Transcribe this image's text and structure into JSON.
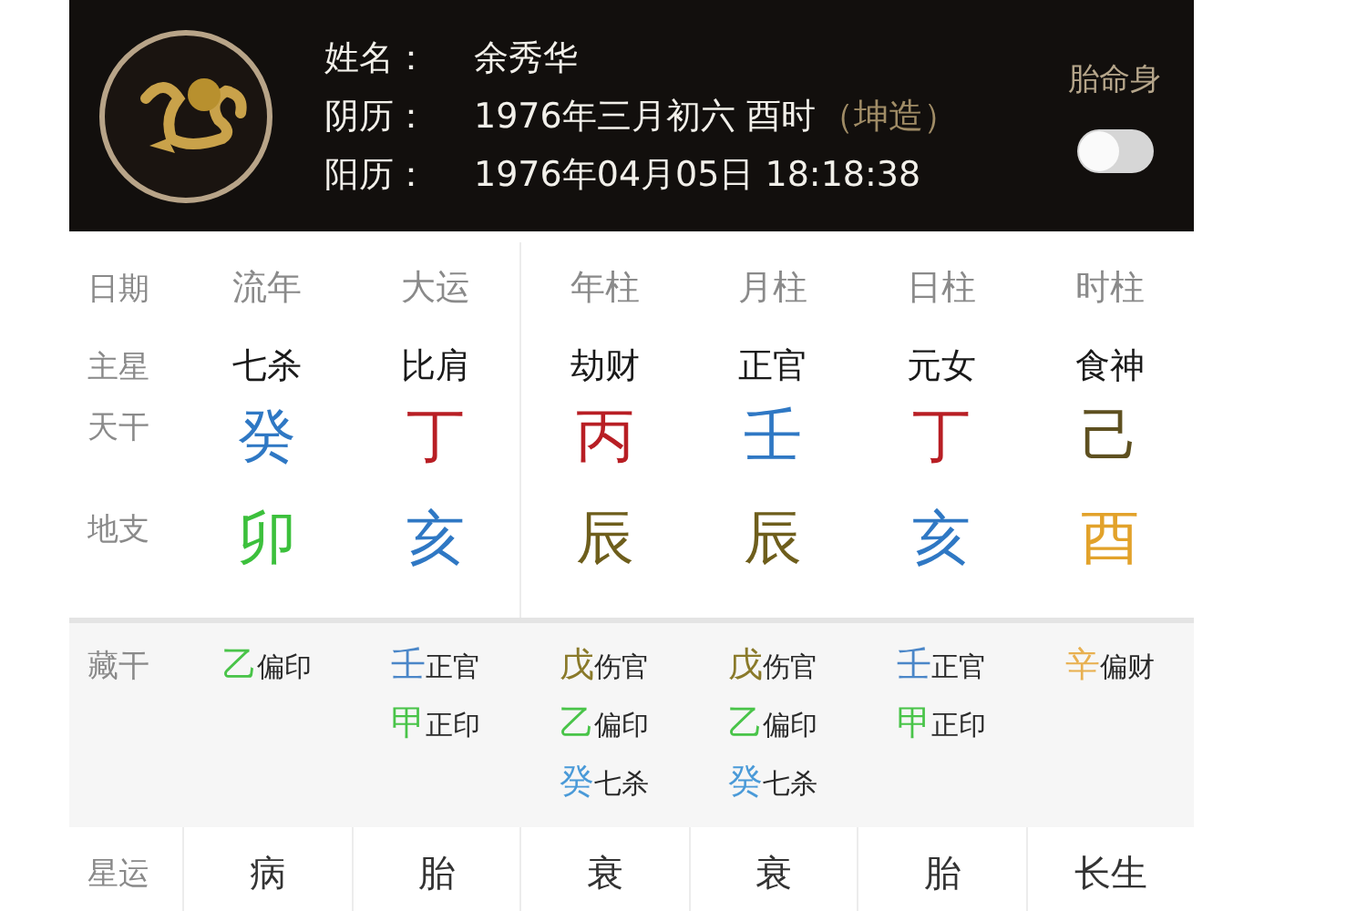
{
  "header": {
    "fields": [
      {
        "label": "姓名：",
        "value": "余秀华"
      },
      {
        "label": "阴历：",
        "value": "1976年三月初六  酉时",
        "note": "（坤造）"
      },
      {
        "label": "阳历：",
        "value": "1976年04月05日 18:18:38"
      }
    ],
    "toggle_label": "胎命身",
    "toggle_on": false
  },
  "labels": {
    "date": "日期",
    "main_star": "主星",
    "stem": "天干",
    "branch": "地支",
    "hidden": "藏干",
    "star_luck": "星运"
  },
  "columns": [
    {
      "header": "流年",
      "main_star": "七杀",
      "stem": {
        "char": "癸",
        "color": "#2f78c4"
      },
      "branch": {
        "char": "卯",
        "color": "#3cc03c"
      },
      "hidden": [
        {
          "stem": "乙",
          "color": "#49c449",
          "god": "偏印"
        }
      ],
      "star_luck": "病"
    },
    {
      "header": "大运",
      "main_star": "比肩",
      "stem": {
        "char": "丁",
        "color": "#b81e24"
      },
      "branch": {
        "char": "亥",
        "color": "#2f78c4"
      },
      "hidden": [
        {
          "stem": "壬",
          "color": "#4a86c8",
          "god": "正官"
        },
        {
          "stem": "甲",
          "color": "#49c449",
          "god": "正印"
        }
      ],
      "star_luck": "胎"
    },
    {
      "header": "年柱",
      "main_star": "劫财",
      "stem": {
        "char": "丙",
        "color": "#b81e24"
      },
      "branch": {
        "char": "辰",
        "color": "#6e5e1c"
      },
      "hidden": [
        {
          "stem": "戊",
          "color": "#8a7a2a",
          "god": "伤官"
        },
        {
          "stem": "乙",
          "color": "#49c449",
          "god": "偏印"
        },
        {
          "stem": "癸",
          "color": "#4a9ad8",
          "god": "七杀"
        }
      ],
      "star_luck": "衰"
    },
    {
      "header": "月柱",
      "main_star": "正官",
      "stem": {
        "char": "壬",
        "color": "#2f78c4"
      },
      "branch": {
        "char": "辰",
        "color": "#6e5e1c"
      },
      "hidden": [
        {
          "stem": "戊",
          "color": "#8a7a2a",
          "god": "伤官"
        },
        {
          "stem": "乙",
          "color": "#49c449",
          "god": "偏印"
        },
        {
          "stem": "癸",
          "color": "#4a9ad8",
          "god": "七杀"
        }
      ],
      "star_luck": "衰"
    },
    {
      "header": "日柱",
      "main_star": "元女",
      "stem": {
        "char": "丁",
        "color": "#b81e24"
      },
      "branch": {
        "char": "亥",
        "color": "#2f78c4"
      },
      "hidden": [
        {
          "stem": "壬",
          "color": "#4a86c8",
          "god": "正官"
        },
        {
          "stem": "甲",
          "color": "#49c449",
          "god": "正印"
        }
      ],
      "star_luck": "胎"
    },
    {
      "header": "时柱",
      "main_star": "食神",
      "stem": {
        "char": "己",
        "color": "#5e5020"
      },
      "branch": {
        "char": "酉",
        "color": "#e2a22a"
      },
      "hidden": [
        {
          "stem": "辛",
          "color": "#e8b050",
          "god": "偏财"
        }
      ],
      "star_luck": "长生"
    }
  ]
}
